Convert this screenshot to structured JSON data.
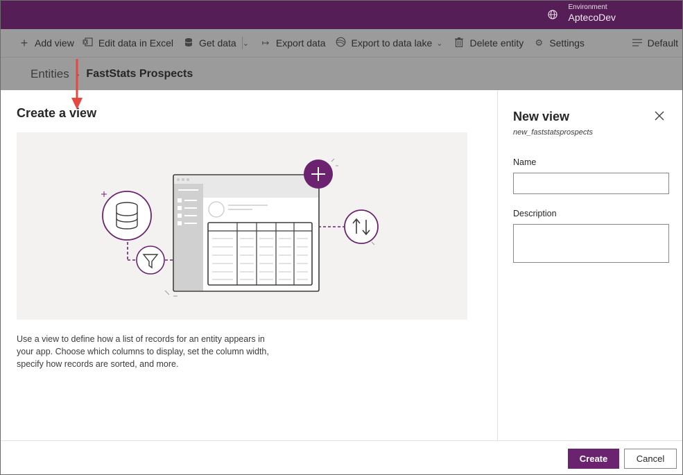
{
  "topbar": {
    "environment_label": "Environment",
    "environment_name": "AptecoDev"
  },
  "commandbar": {
    "items": [
      {
        "label": "Add view",
        "icon": "plus-icon"
      },
      {
        "label": "Edit data in Excel",
        "icon": "excel-icon"
      },
      {
        "label": "Get data",
        "icon": "database-icon"
      },
      {
        "label": "Export data",
        "icon": "export-icon"
      },
      {
        "label": "Export to data lake",
        "icon": "data-lake-icon"
      },
      {
        "label": "Delete entity",
        "icon": "trash-icon"
      },
      {
        "label": "Settings",
        "icon": "gear-icon"
      }
    ],
    "right_label": "Default"
  },
  "breadcrumb": {
    "parent": "Entities",
    "current": "FastStats Prospects"
  },
  "main": {
    "title": "Create a view",
    "description": "Use a view to define how a list of records for an entity appears in your app. Choose which columns to display, set the column width, specify how records are sorted, and more."
  },
  "panel": {
    "title": "New view",
    "schema_name": "new_faststatsprospects",
    "name_label": "Name",
    "name_value": "",
    "description_label": "Description",
    "description_value": ""
  },
  "footer": {
    "create_label": "Create",
    "cancel_label": "Cancel"
  },
  "colors": {
    "brand": "#561e56",
    "primary_button": "#6b2370",
    "annotation_arrow": "#e8473f"
  }
}
